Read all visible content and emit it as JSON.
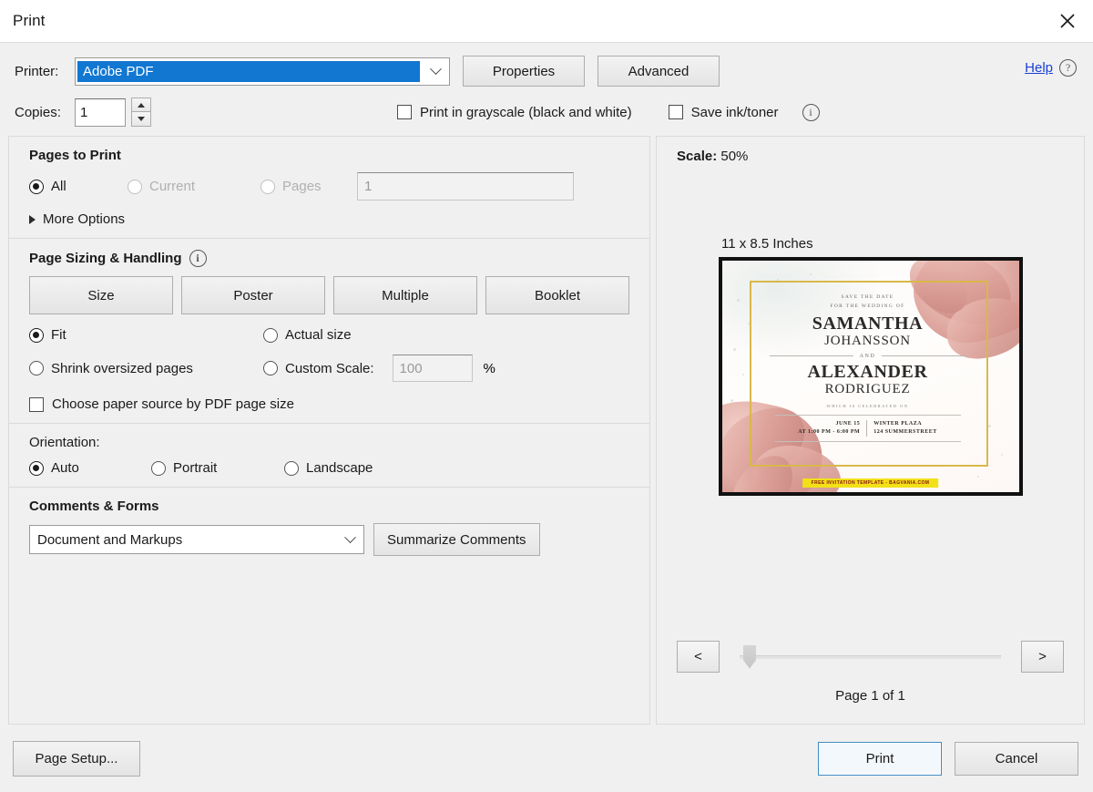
{
  "window": {
    "title": "Print",
    "close_label": "×"
  },
  "header": {
    "printer_label": "Printer:",
    "printer_value": "Adobe PDF",
    "properties_label": "Properties",
    "advanced_label": "Advanced",
    "help_label": "Help",
    "help_icon": "question-circle-icon",
    "copies_label": "Copies:",
    "copies_value": "1",
    "grayscale_label": "Print in grayscale (black and white)",
    "grayscale_checked": false,
    "save_ink_label": "Save ink/toner",
    "save_ink_checked": false,
    "info_icon": "info-circle-icon"
  },
  "pages_to_print": {
    "title": "Pages to Print",
    "options": [
      {
        "label": "All",
        "selected": true,
        "enabled": true
      },
      {
        "label": "Current",
        "selected": false,
        "enabled": false
      },
      {
        "label": "Pages",
        "selected": false,
        "enabled": false
      }
    ],
    "pages_input_value": "1",
    "more_options_label": "More Options",
    "more_options_expanded": false
  },
  "page_sizing": {
    "title": "Page Sizing & Handling",
    "info_icon": "info-circle-icon",
    "buttons": [
      {
        "label": "Size",
        "accesskey": "i"
      },
      {
        "label": "Poster"
      },
      {
        "label": "Multiple"
      },
      {
        "label": "Booklet"
      }
    ],
    "fit_label": "Fit",
    "fit_selected": true,
    "actual_size_label": "Actual size",
    "actual_size_selected": false,
    "shrink_label": "Shrink oversized pages",
    "shrink_selected": false,
    "custom_scale_label": "Custom Scale:",
    "custom_scale_selected": false,
    "custom_scale_value": "100",
    "percent_sign": "%",
    "paper_source_label": "Choose paper source by PDF page size",
    "paper_source_checked": false
  },
  "orientation": {
    "title": "Orientation:",
    "options": [
      {
        "label": "Auto",
        "selected": true
      },
      {
        "label": "Portrait",
        "selected": false
      },
      {
        "label": "Landscape",
        "selected": false
      }
    ]
  },
  "comments_forms": {
    "title": "Comments & Forms",
    "selected": "Document and Markups",
    "summarize_label": "Summarize Comments"
  },
  "preview": {
    "scale_label": "Scale:",
    "scale_value": "50%",
    "sheet_size": "11 x 8.5 Inches",
    "prev_label": "<",
    "next_label": ">",
    "page_count": "Page 1 of 1",
    "document": {
      "save_the_date": "SAVE THE DATE",
      "for_the_wedding": "FOR THE WEDDING OF",
      "bride_first": "SAMANTHA",
      "bride_last": "JOHANSSON",
      "and": "AND",
      "groom_first": "ALEXANDER",
      "groom_last": "RODRIGUEZ",
      "who_note": "WHICH IS CELEBRATED ON",
      "date": "JUNE 15",
      "time": "AT 1:00 PM - 6:00 PM",
      "venue": "WINTER PLAZA",
      "address": "124 SUMMERSTREET",
      "banner": "FREE INVITATION TEMPLATE - BAGVANIA.COM"
    }
  },
  "footer": {
    "page_setup_label": "Page Setup...",
    "print_label": "Print",
    "cancel_label": "Cancel"
  },
  "colors": {
    "accent_blue": "#1177d1",
    "link_blue": "#1a3fd6",
    "primary_btn_border": "#3f8cc4",
    "dialog_bg": "#f0f0f0",
    "gold": "#d9b84a",
    "banner_yellow": "#f2e117"
  }
}
